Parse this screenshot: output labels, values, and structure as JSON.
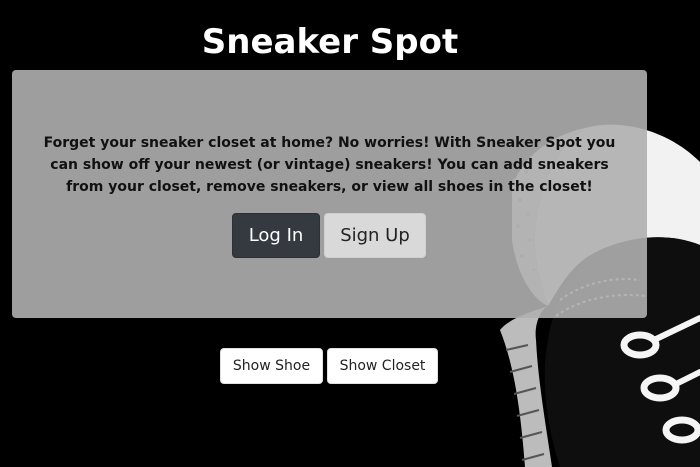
{
  "header": {
    "title": "Sneaker Spot"
  },
  "hero": {
    "description": "Forget your sneaker closet at home? No worries! With Sneaker Spot you can show off your newest (or vintage) sneakers! You can add sneakers from your closet, remove sneakers, or view all shoes in the closet!",
    "login_label": "Log In",
    "signup_label": "Sign Up"
  },
  "actions": {
    "show_shoe_label": "Show Shoe",
    "show_closet_label": "Show Closet"
  },
  "background": {
    "image": "sneaker-illustration"
  },
  "colors": {
    "page_background": "#000000",
    "card_background": "#afafaf",
    "login_button": "#343a40",
    "signup_button": "#d9d9d9",
    "small_button": "#ffffff"
  }
}
